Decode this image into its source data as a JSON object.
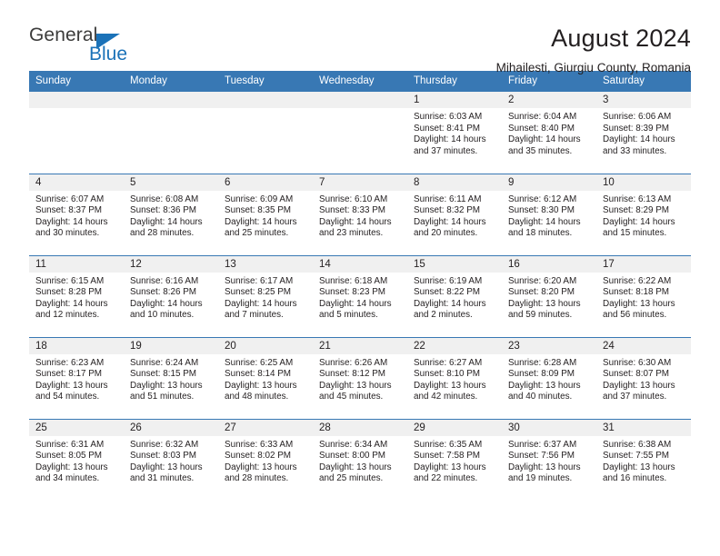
{
  "brand": {
    "name_part1": "General",
    "name_part2": "Blue",
    "accent_color": "#1b72b8"
  },
  "header": {
    "title": "August 2024",
    "subtitle": "Mihailesti, Giurgiu County, Romania"
  },
  "theme": {
    "header_bg": "#3878b4",
    "header_text": "#ffffff",
    "daynum_band_bg": "#f0f0f0",
    "cell_bg": "#ffffff",
    "text": "#231f20"
  },
  "weekday_headers": [
    "Sunday",
    "Monday",
    "Tuesday",
    "Wednesday",
    "Thursday",
    "Friday",
    "Saturday"
  ],
  "labels": {
    "sunrise": "Sunrise:",
    "sunset": "Sunset:",
    "daylight": "Daylight:"
  },
  "weeks": [
    [
      {
        "blank": true,
        "day": ""
      },
      {
        "blank": true,
        "day": ""
      },
      {
        "blank": true,
        "day": ""
      },
      {
        "blank": true,
        "day": ""
      },
      {
        "blank": false,
        "day": "1",
        "sunrise": "Sunrise: 6:03 AM",
        "sunset": "Sunset: 8:41 PM",
        "daylight_line1": "Daylight: 14 hours",
        "daylight_line2": "and 37 minutes."
      },
      {
        "blank": false,
        "day": "2",
        "sunrise": "Sunrise: 6:04 AM",
        "sunset": "Sunset: 8:40 PM",
        "daylight_line1": "Daylight: 14 hours",
        "daylight_line2": "and 35 minutes."
      },
      {
        "blank": false,
        "day": "3",
        "sunrise": "Sunrise: 6:06 AM",
        "sunset": "Sunset: 8:39 PM",
        "daylight_line1": "Daylight: 14 hours",
        "daylight_line2": "and 33 minutes."
      }
    ],
    [
      {
        "blank": false,
        "day": "4",
        "sunrise": "Sunrise: 6:07 AM",
        "sunset": "Sunset: 8:37 PM",
        "daylight_line1": "Daylight: 14 hours",
        "daylight_line2": "and 30 minutes."
      },
      {
        "blank": false,
        "day": "5",
        "sunrise": "Sunrise: 6:08 AM",
        "sunset": "Sunset: 8:36 PM",
        "daylight_line1": "Daylight: 14 hours",
        "daylight_line2": "and 28 minutes."
      },
      {
        "blank": false,
        "day": "6",
        "sunrise": "Sunrise: 6:09 AM",
        "sunset": "Sunset: 8:35 PM",
        "daylight_line1": "Daylight: 14 hours",
        "daylight_line2": "and 25 minutes."
      },
      {
        "blank": false,
        "day": "7",
        "sunrise": "Sunrise: 6:10 AM",
        "sunset": "Sunset: 8:33 PM",
        "daylight_line1": "Daylight: 14 hours",
        "daylight_line2": "and 23 minutes."
      },
      {
        "blank": false,
        "day": "8",
        "sunrise": "Sunrise: 6:11 AM",
        "sunset": "Sunset: 8:32 PM",
        "daylight_line1": "Daylight: 14 hours",
        "daylight_line2": "and 20 minutes."
      },
      {
        "blank": false,
        "day": "9",
        "sunrise": "Sunrise: 6:12 AM",
        "sunset": "Sunset: 8:30 PM",
        "daylight_line1": "Daylight: 14 hours",
        "daylight_line2": "and 18 minutes."
      },
      {
        "blank": false,
        "day": "10",
        "sunrise": "Sunrise: 6:13 AM",
        "sunset": "Sunset: 8:29 PM",
        "daylight_line1": "Daylight: 14 hours",
        "daylight_line2": "and 15 minutes."
      }
    ],
    [
      {
        "blank": false,
        "day": "11",
        "sunrise": "Sunrise: 6:15 AM",
        "sunset": "Sunset: 8:28 PM",
        "daylight_line1": "Daylight: 14 hours",
        "daylight_line2": "and 12 minutes."
      },
      {
        "blank": false,
        "day": "12",
        "sunrise": "Sunrise: 6:16 AM",
        "sunset": "Sunset: 8:26 PM",
        "daylight_line1": "Daylight: 14 hours",
        "daylight_line2": "and 10 minutes."
      },
      {
        "blank": false,
        "day": "13",
        "sunrise": "Sunrise: 6:17 AM",
        "sunset": "Sunset: 8:25 PM",
        "daylight_line1": "Daylight: 14 hours",
        "daylight_line2": "and 7 minutes."
      },
      {
        "blank": false,
        "day": "14",
        "sunrise": "Sunrise: 6:18 AM",
        "sunset": "Sunset: 8:23 PM",
        "daylight_line1": "Daylight: 14 hours",
        "daylight_line2": "and 5 minutes."
      },
      {
        "blank": false,
        "day": "15",
        "sunrise": "Sunrise: 6:19 AM",
        "sunset": "Sunset: 8:22 PM",
        "daylight_line1": "Daylight: 14 hours",
        "daylight_line2": "and 2 minutes."
      },
      {
        "blank": false,
        "day": "16",
        "sunrise": "Sunrise: 6:20 AM",
        "sunset": "Sunset: 8:20 PM",
        "daylight_line1": "Daylight: 13 hours",
        "daylight_line2": "and 59 minutes."
      },
      {
        "blank": false,
        "day": "17",
        "sunrise": "Sunrise: 6:22 AM",
        "sunset": "Sunset: 8:18 PM",
        "daylight_line1": "Daylight: 13 hours",
        "daylight_line2": "and 56 minutes."
      }
    ],
    [
      {
        "blank": false,
        "day": "18",
        "sunrise": "Sunrise: 6:23 AM",
        "sunset": "Sunset: 8:17 PM",
        "daylight_line1": "Daylight: 13 hours",
        "daylight_line2": "and 54 minutes."
      },
      {
        "blank": false,
        "day": "19",
        "sunrise": "Sunrise: 6:24 AM",
        "sunset": "Sunset: 8:15 PM",
        "daylight_line1": "Daylight: 13 hours",
        "daylight_line2": "and 51 minutes."
      },
      {
        "blank": false,
        "day": "20",
        "sunrise": "Sunrise: 6:25 AM",
        "sunset": "Sunset: 8:14 PM",
        "daylight_line1": "Daylight: 13 hours",
        "daylight_line2": "and 48 minutes."
      },
      {
        "blank": false,
        "day": "21",
        "sunrise": "Sunrise: 6:26 AM",
        "sunset": "Sunset: 8:12 PM",
        "daylight_line1": "Daylight: 13 hours",
        "daylight_line2": "and 45 minutes."
      },
      {
        "blank": false,
        "day": "22",
        "sunrise": "Sunrise: 6:27 AM",
        "sunset": "Sunset: 8:10 PM",
        "daylight_line1": "Daylight: 13 hours",
        "daylight_line2": "and 42 minutes."
      },
      {
        "blank": false,
        "day": "23",
        "sunrise": "Sunrise: 6:28 AM",
        "sunset": "Sunset: 8:09 PM",
        "daylight_line1": "Daylight: 13 hours",
        "daylight_line2": "and 40 minutes."
      },
      {
        "blank": false,
        "day": "24",
        "sunrise": "Sunrise: 6:30 AM",
        "sunset": "Sunset: 8:07 PM",
        "daylight_line1": "Daylight: 13 hours",
        "daylight_line2": "and 37 minutes."
      }
    ],
    [
      {
        "blank": false,
        "day": "25",
        "sunrise": "Sunrise: 6:31 AM",
        "sunset": "Sunset: 8:05 PM",
        "daylight_line1": "Daylight: 13 hours",
        "daylight_line2": "and 34 minutes."
      },
      {
        "blank": false,
        "day": "26",
        "sunrise": "Sunrise: 6:32 AM",
        "sunset": "Sunset: 8:03 PM",
        "daylight_line1": "Daylight: 13 hours",
        "daylight_line2": "and 31 minutes."
      },
      {
        "blank": false,
        "day": "27",
        "sunrise": "Sunrise: 6:33 AM",
        "sunset": "Sunset: 8:02 PM",
        "daylight_line1": "Daylight: 13 hours",
        "daylight_line2": "and 28 minutes."
      },
      {
        "blank": false,
        "day": "28",
        "sunrise": "Sunrise: 6:34 AM",
        "sunset": "Sunset: 8:00 PM",
        "daylight_line1": "Daylight: 13 hours",
        "daylight_line2": "and 25 minutes."
      },
      {
        "blank": false,
        "day": "29",
        "sunrise": "Sunrise: 6:35 AM",
        "sunset": "Sunset: 7:58 PM",
        "daylight_line1": "Daylight: 13 hours",
        "daylight_line2": "and 22 minutes."
      },
      {
        "blank": false,
        "day": "30",
        "sunrise": "Sunrise: 6:37 AM",
        "sunset": "Sunset: 7:56 PM",
        "daylight_line1": "Daylight: 13 hours",
        "daylight_line2": "and 19 minutes."
      },
      {
        "blank": false,
        "day": "31",
        "sunrise": "Sunrise: 6:38 AM",
        "sunset": "Sunset: 7:55 PM",
        "daylight_line1": "Daylight: 13 hours",
        "daylight_line2": "and 16 minutes."
      }
    ]
  ]
}
